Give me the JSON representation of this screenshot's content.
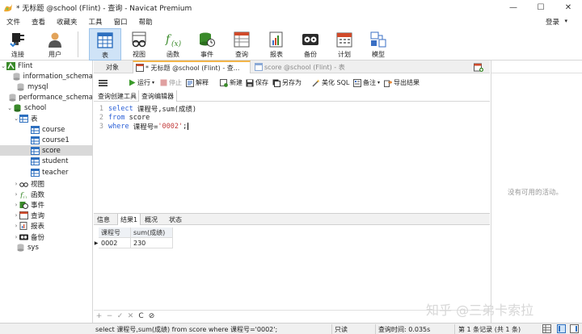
{
  "window": {
    "title": "* 无标题 @school (Flint) - 查询 - Navicat Premium",
    "minimize": "—",
    "maximize": "☐",
    "close": "✕"
  },
  "menu": {
    "items": [
      "文件",
      "查看",
      "收藏夹",
      "工具",
      "窗口",
      "帮助"
    ],
    "login": "登录",
    "login_caret": "▾"
  },
  "toolbar": {
    "connect": "连接",
    "user": "用户",
    "table": "表",
    "view": "视图",
    "function": "函数",
    "event": "事件",
    "query": "查询",
    "report": "报表",
    "backup": "备份",
    "schedule": "计划",
    "model": "模型"
  },
  "tree": {
    "root": "Flint",
    "databases": [
      "information_schema",
      "mysql",
      "performance_schema"
    ],
    "school": "school",
    "tables_node": "表",
    "tables": [
      "course",
      "course1",
      "score",
      "student",
      "teacher"
    ],
    "views": "视图",
    "functions": "函数",
    "events": "事件",
    "queries": "查询",
    "reports": "报表",
    "backups": "备份",
    "sys": "sys"
  },
  "tabs": {
    "objects": "对象",
    "query_tab": "* 无标题 @school (Flint) - 查...",
    "score_tab": "score @school (Flint) - 表"
  },
  "query_toolbar": {
    "run": "运行",
    "run_caret": "▾",
    "stop": "停止",
    "explain": "解释",
    "new": "新建",
    "save": "保存",
    "save_as": "另存为",
    "beautify": "美化 SQL",
    "note": "备注",
    "note_caret": "▾",
    "export": "导出结果"
  },
  "subtabs": {
    "builder": "查询创建工具",
    "editor": "查询编辑器"
  },
  "editor": {
    "lines": [
      {
        "num": "1",
        "kw": "select",
        "rest": " 课程号,sum(成绩)"
      },
      {
        "num": "2",
        "kw": "from",
        "rest": " score"
      },
      {
        "num": "3",
        "kw": "where",
        "rest": " 课程号=",
        "str": "'0002'",
        "tail": ";"
      }
    ]
  },
  "result_tabs": [
    "信息",
    "结果1",
    "概况",
    "状态"
  ],
  "grid": {
    "columns": [
      "课程号",
      "sum(成绩)"
    ],
    "rows": [
      [
        "0002",
        "230"
      ]
    ],
    "row_marker": "▶"
  },
  "nav": {
    "add": "+",
    "remove": "−",
    "apply": "✓",
    "discard": "✕",
    "refresh": "C",
    "stop": "⊘"
  },
  "right_panel": {
    "empty_text": "没有可用的活动。"
  },
  "watermark": "知乎 @三弟卡索拉",
  "status": {
    "sql": "select 课程号,sum(成绩) from score where 课程号='0002';",
    "mode": "只读",
    "time": "查询时间: 0.035s",
    "records": "第 1 条记录 (共 1 条)"
  }
}
